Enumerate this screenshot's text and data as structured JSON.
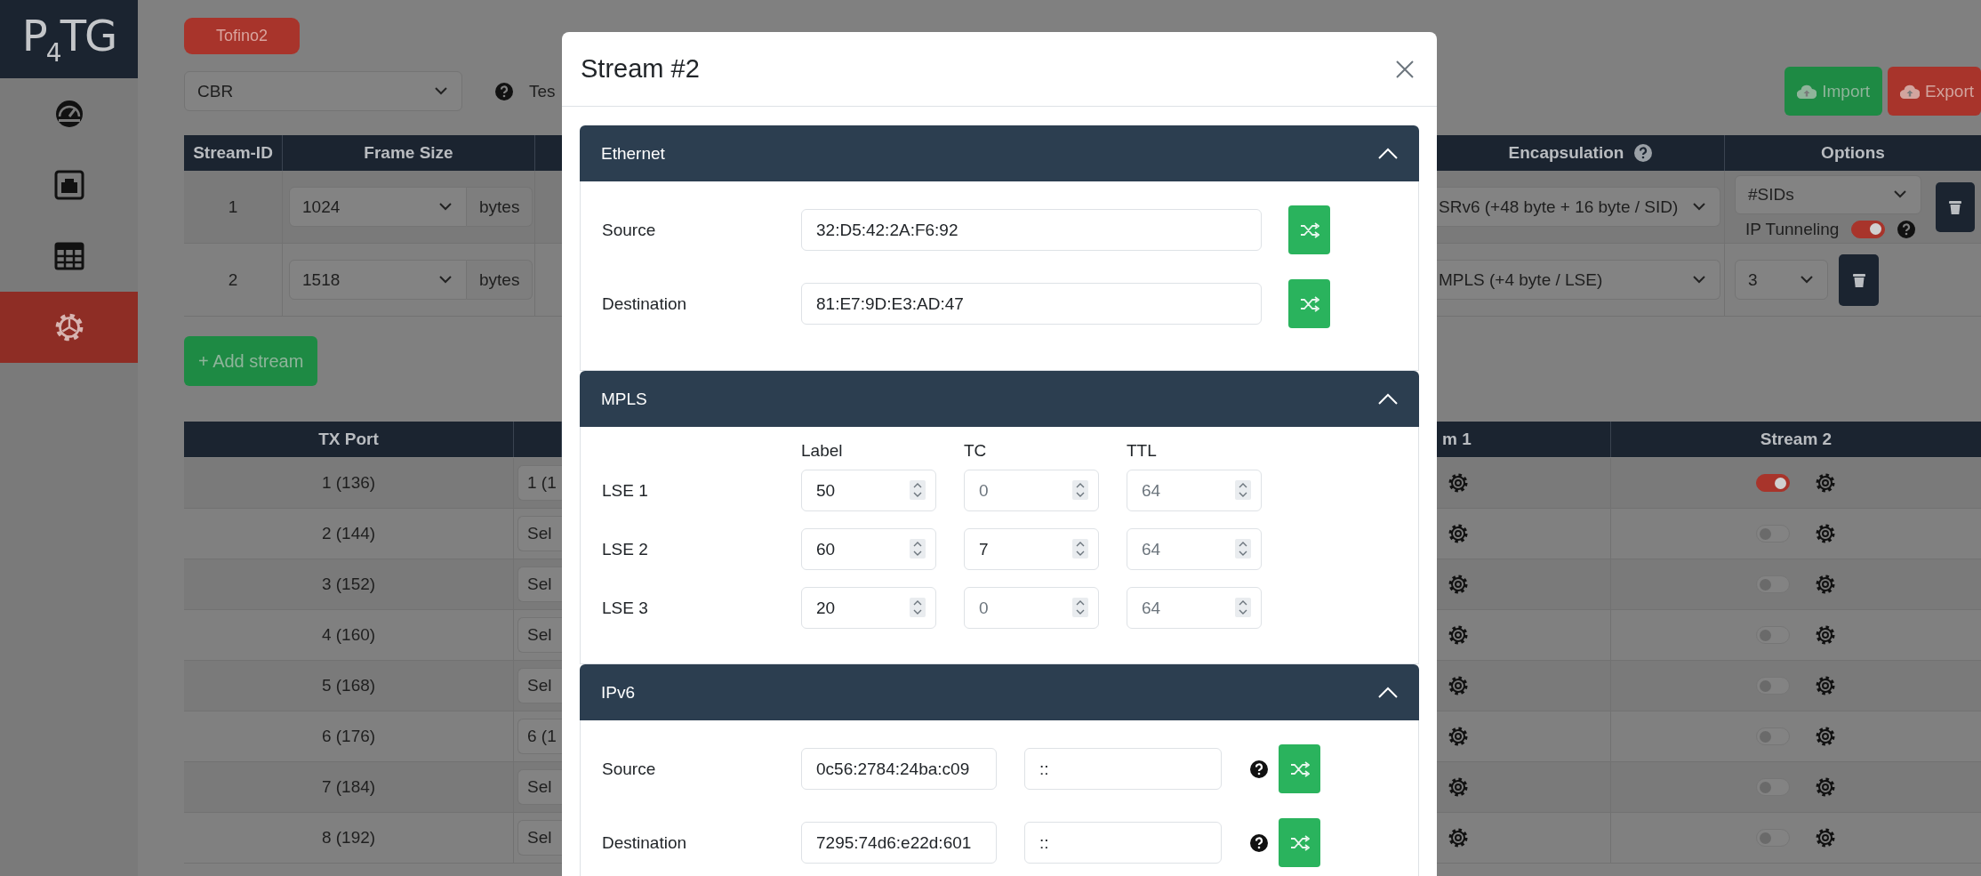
{
  "sidebar": {
    "logo": "P$_{4}$TG",
    "items": [
      {
        "kind": "dashboard",
        "selected": false
      },
      {
        "kind": "ports",
        "selected": false
      },
      {
        "kind": "table",
        "selected": false
      },
      {
        "kind": "settings",
        "selected": true
      }
    ]
  },
  "device_badge": "Tofino2",
  "mode_select": {
    "value": "CBR"
  },
  "test_label": "Tes",
  "import_button": "Import",
  "export_button": "Export",
  "streams_table": {
    "columns": [
      "Stream-ID",
      "Frame Size",
      "Encapsulation",
      "Options"
    ],
    "rows": [
      {
        "stream_id": "1",
        "frame_size": "1024",
        "unit": "bytes",
        "encapsulation": "SRv6 (+48 byte + 16 byte / SID)",
        "options": {
          "kind": "sids",
          "placeholder": "#SIDs",
          "tunneling_label": "IP Tunneling",
          "ip_tunneling": true
        }
      },
      {
        "stream_id": "2",
        "frame_size": "1518",
        "unit": "bytes",
        "encapsulation": "MPLS (+4 byte / LSE)",
        "options": {
          "kind": "lse_count",
          "value": "3"
        }
      }
    ]
  },
  "add_stream_button": "+ Add stream",
  "ports_table": {
    "columns": [
      "TX Port",
      "m 1",
      "Stream 2"
    ],
    "rows": [
      {
        "tx_port": "1 (136)",
        "column_2": "1 (1",
        "stream_2_on": true
      },
      {
        "tx_port": "2 (144)",
        "column_2": "Sel",
        "stream_2_on": false
      },
      {
        "tx_port": "3 (152)",
        "column_2": "Sel",
        "stream_2_on": false
      },
      {
        "tx_port": "4 (160)",
        "column_2": "Sel",
        "stream_2_on": false
      },
      {
        "tx_port": "5 (168)",
        "column_2": "Sel",
        "stream_2_on": false
      },
      {
        "tx_port": "6 (176)",
        "column_2": "6 (1",
        "stream_2_on": false
      },
      {
        "tx_port": "7 (184)",
        "column_2": "Sel",
        "stream_2_on": false
      },
      {
        "tx_port": "8 (192)",
        "column_2": "Sel",
        "stream_2_on": false
      }
    ]
  },
  "modal": {
    "title": "Stream #2",
    "sections": [
      {
        "kind": "ethernet",
        "title": "Ethernet",
        "expanded": true,
        "rows": [
          {
            "label": "Source",
            "value": "32:D5:42:2A:F6:92"
          },
          {
            "label": "Destination",
            "value": "81:E7:9D:E3:AD:47"
          }
        ]
      },
      {
        "kind": "mpls",
        "title": "MPLS",
        "expanded": true,
        "columns": [
          "Label",
          "TC",
          "TTL"
        ],
        "rows": [
          {
            "label": "LSE 1",
            "cells": [
              {
                "value": "50"
              },
              {
                "placeholder": "0"
              },
              {
                "placeholder": "64"
              }
            ]
          },
          {
            "label": "LSE 2",
            "cells": [
              {
                "value": "60"
              },
              {
                "value": "7"
              },
              {
                "placeholder": "64"
              }
            ]
          },
          {
            "label": "LSE 3",
            "cells": [
              {
                "value": "20"
              },
              {
                "placeholder": "0"
              },
              {
                "placeholder": "64"
              }
            ]
          }
        ]
      },
      {
        "kind": "ipv6",
        "title": "IPv6",
        "expanded": true,
        "rows": [
          {
            "label": "Source",
            "value": "0c56:2784:24ba:c09",
            "mask": "::"
          },
          {
            "label": "Destination",
            "value": "7295:74d6:e22d:601",
            "mask": "::"
          }
        ]
      }
    ]
  }
}
